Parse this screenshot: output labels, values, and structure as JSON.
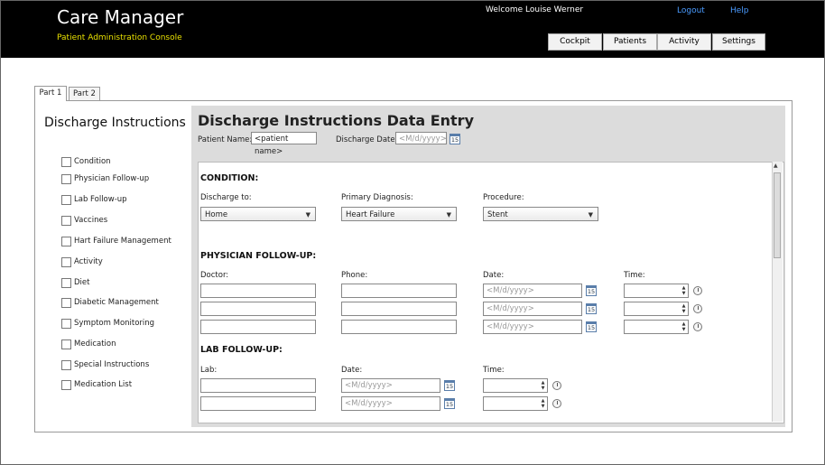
{
  "app": {
    "title": "Care Manager",
    "subtitle": "Patient Administration Console",
    "welcome": "Welcome Louise Werner",
    "links": {
      "logout": "Logout",
      "help": "Help"
    },
    "nav": [
      "Cockpit",
      "Patients",
      "Activity",
      "Settings"
    ]
  },
  "tabs": [
    "Part 1",
    "Part 2"
  ],
  "sidebar": {
    "title": "Discharge Instructions",
    "items": [
      "Condition",
      "Physician Follow-up",
      "Lab Follow-up",
      "Vaccines",
      "Hart Failure Management",
      "Activity",
      "Diet",
      "Diabetic Management",
      "Symptom Monitoring",
      "Medication",
      "Special Instructions",
      "Medication List"
    ]
  },
  "form": {
    "title": "Discharge Instructions Data Entry",
    "patient_name_label": "Patient Name:",
    "patient_name_value": "<patient name>",
    "discharge_date_label": "Discharge Date:",
    "date_placeholder": "<M/d/yyyy>",
    "calendar_glyph": "15",
    "condition": {
      "heading": "CONDITION:",
      "discharge_to_label": "Discharge to:",
      "discharge_to_value": "Home",
      "primary_dx_label": "Primary Diagnosis:",
      "primary_dx_value": "Heart Failure",
      "procedure_label": "Procedure:",
      "procedure_value": "Stent"
    },
    "physician": {
      "heading": "PHYSICIAN FOLLOW-UP:",
      "doctor_label": "Doctor:",
      "phone_label": "Phone:",
      "date_label": "Date:",
      "time_label": "Time:"
    },
    "lab": {
      "heading": "LAB FOLLOW-UP:",
      "lab_label": "Lab:",
      "date_label": "Date:",
      "time_label": "Time:"
    }
  },
  "colors": {
    "header_bg": "#000000",
    "subtitle": "#e8e000",
    "link": "#4a9bff",
    "content_bg": "#dcdcdc"
  }
}
